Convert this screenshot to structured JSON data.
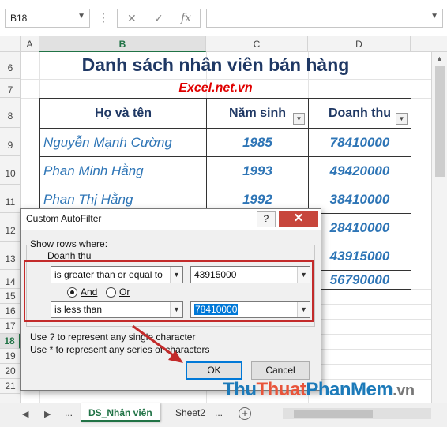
{
  "formula_bar": {
    "name_box": "B18",
    "cancel_symbol": "✕",
    "enter_symbol": "✓",
    "fx_label": "fx",
    "formula_value": ""
  },
  "columns": [
    "A",
    "B",
    "C",
    "D"
  ],
  "rows": [
    "6",
    "7",
    "8",
    "9",
    "10",
    "11",
    "12",
    "13",
    "14",
    "15",
    "16",
    "17",
    "18",
    "19",
    "20",
    "21"
  ],
  "selected_column": "B",
  "selected_row": "18",
  "sheet": {
    "title": "Danh sách nhân viên bán hàng",
    "subtitle": "Excel.net.vn",
    "headers": [
      "Họ và tên",
      "Năm sinh",
      "Doanh thu"
    ],
    "records": [
      {
        "name": "Nguyễn  Mạnh Cường",
        "year": "1985",
        "revenue": "78410000"
      },
      {
        "name": "Phan  Minh Hằng",
        "year": "1993",
        "revenue": "49420000"
      },
      {
        "name": "Phan  Thị Hằng",
        "year": "1992",
        "revenue": "38410000"
      },
      {
        "name": "",
        "year": "",
        "revenue": "28410000"
      },
      {
        "name": "",
        "year": "",
        "revenue": "43915000"
      },
      {
        "name": "",
        "year": "",
        "revenue": "56790000"
      }
    ]
  },
  "dialog": {
    "title": "Custom AutoFilter",
    "help_label": "?",
    "close_label": "✕",
    "show_rows_label": "Show rows where:",
    "field_label": "Doanh thu",
    "condition1_operator": "is greater than or equal to",
    "condition1_value": "43915000",
    "and_label": "And",
    "or_label": "Or",
    "logic_selected": "And",
    "condition2_operator": "is less than",
    "condition2_value": "78410000",
    "hint1": "Use ? to represent any single character",
    "hint2": "Use * to represent any series of characters",
    "ok_label": "OK",
    "cancel_label": "Cancel"
  },
  "tabs": {
    "more_left": "...",
    "items": [
      "DS_Nhân viên",
      "Sheet2"
    ],
    "active": "DS_Nhân viên",
    "more_right": "..."
  },
  "watermark": {
    "part1": "Thu",
    "part2": "Thuat",
    "part3": "PhanMem",
    "part4": ".vn"
  },
  "colors": {
    "accent": "#217346",
    "title_color": "#1f3864",
    "subtitle_color": "#e00000",
    "data_color": "#2e75b6",
    "highlight_box": "#c32b2b"
  }
}
